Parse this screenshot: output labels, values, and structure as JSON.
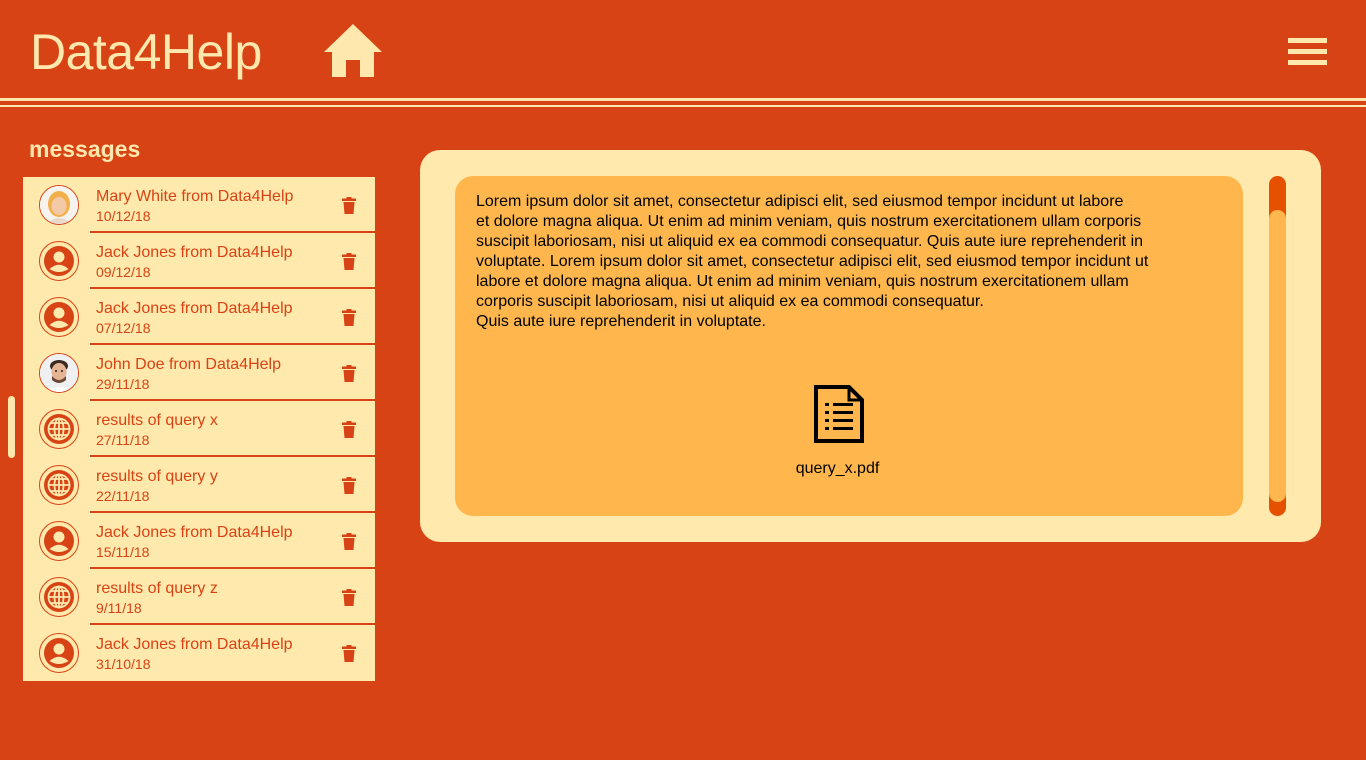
{
  "header": {
    "app_title": "Data4Help",
    "home_icon": "home-icon",
    "menu_icon": "hamburger-menu-icon"
  },
  "sidebar": {
    "heading": "messages",
    "items": [
      {
        "name": "Mary White from Data4Help",
        "date": "10/12/18",
        "avatar": "photo-woman"
      },
      {
        "name": "Jack Jones from Data4Help",
        "date": "09/12/18",
        "avatar": "user-icon"
      },
      {
        "name": "Jack Jones from Data4Help",
        "date": "07/12/18",
        "avatar": "user-icon"
      },
      {
        "name": "John Doe from Data4Help",
        "date": "29/11/18",
        "avatar": "photo-man"
      },
      {
        "name": "results of query x",
        "date": "27/11/18",
        "avatar": "globe-icon"
      },
      {
        "name": "results of query y",
        "date": "22/11/18",
        "avatar": "globe-icon"
      },
      {
        "name": "Jack Jones from Data4Help",
        "date": "15/11/18",
        "avatar": "user-icon"
      },
      {
        "name": "results of query z",
        "date": "9/11/18",
        "avatar": "globe-icon"
      },
      {
        "name": "Jack Jones from Data4Help",
        "date": "31/10/18",
        "avatar": "user-icon"
      }
    ]
  },
  "message": {
    "body": " Lorem ipsum dolor sit amet, consectetur adipisci elit, sed eiusmod tempor incidunt ut labore\n et dolore  magna  aliqua. Ut enim ad minim veniam, quis nostrum exercitationem ullam corporis\nsuscipit laboriosam,  nisi ut aliquid  ex ea commodi consequatur. Quis aute iure reprehenderit in\nvoluptate.  Lorem ipsum dolor sit amet, consectetur adipisci elit, sed eiusmod tempor incidunt ut\nlabore et dolore  magna  aliqua. Ut enim ad minim veniam, quis nostrum exercitationem ullam\ncorporis suscipit laboriosam,  nisi ut aliquid  ex ea commodi consequatur.\nQuis aute iure reprehenderit in voluptate.",
    "attachment_name": "query_x.pdf",
    "attachment_icon": "document-icon"
  },
  "colors": {
    "background": "#d84315",
    "cream": "#ffe9ad",
    "message_bg": "#ffb74d",
    "accent": "#d84315"
  }
}
